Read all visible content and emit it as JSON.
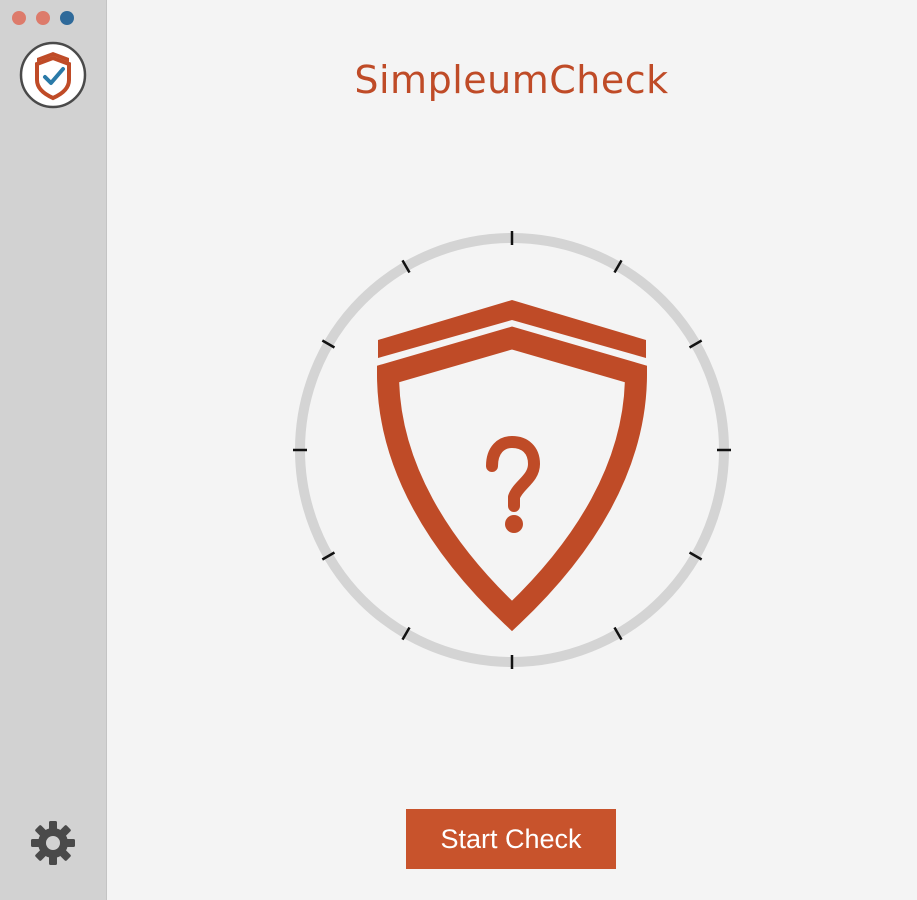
{
  "app": {
    "title": "SimpleumCheck"
  },
  "window_controls": {
    "close_color": "#dd7b6b",
    "minimize_color": "#dd7b6b",
    "zoom_color": "#2f6a9a"
  },
  "sidebar": {
    "app_icon": "shield-check-icon",
    "settings_icon": "gear-icon"
  },
  "status": {
    "icon": "shield-question-icon"
  },
  "actions": {
    "start_label": "Start Check"
  },
  "colors": {
    "accent": "#bf4b27",
    "button": "#c8532c",
    "ring": "#d4d4d4",
    "tick": "#111111",
    "gear": "#4a4a4a",
    "check": "#2a7aa8"
  }
}
